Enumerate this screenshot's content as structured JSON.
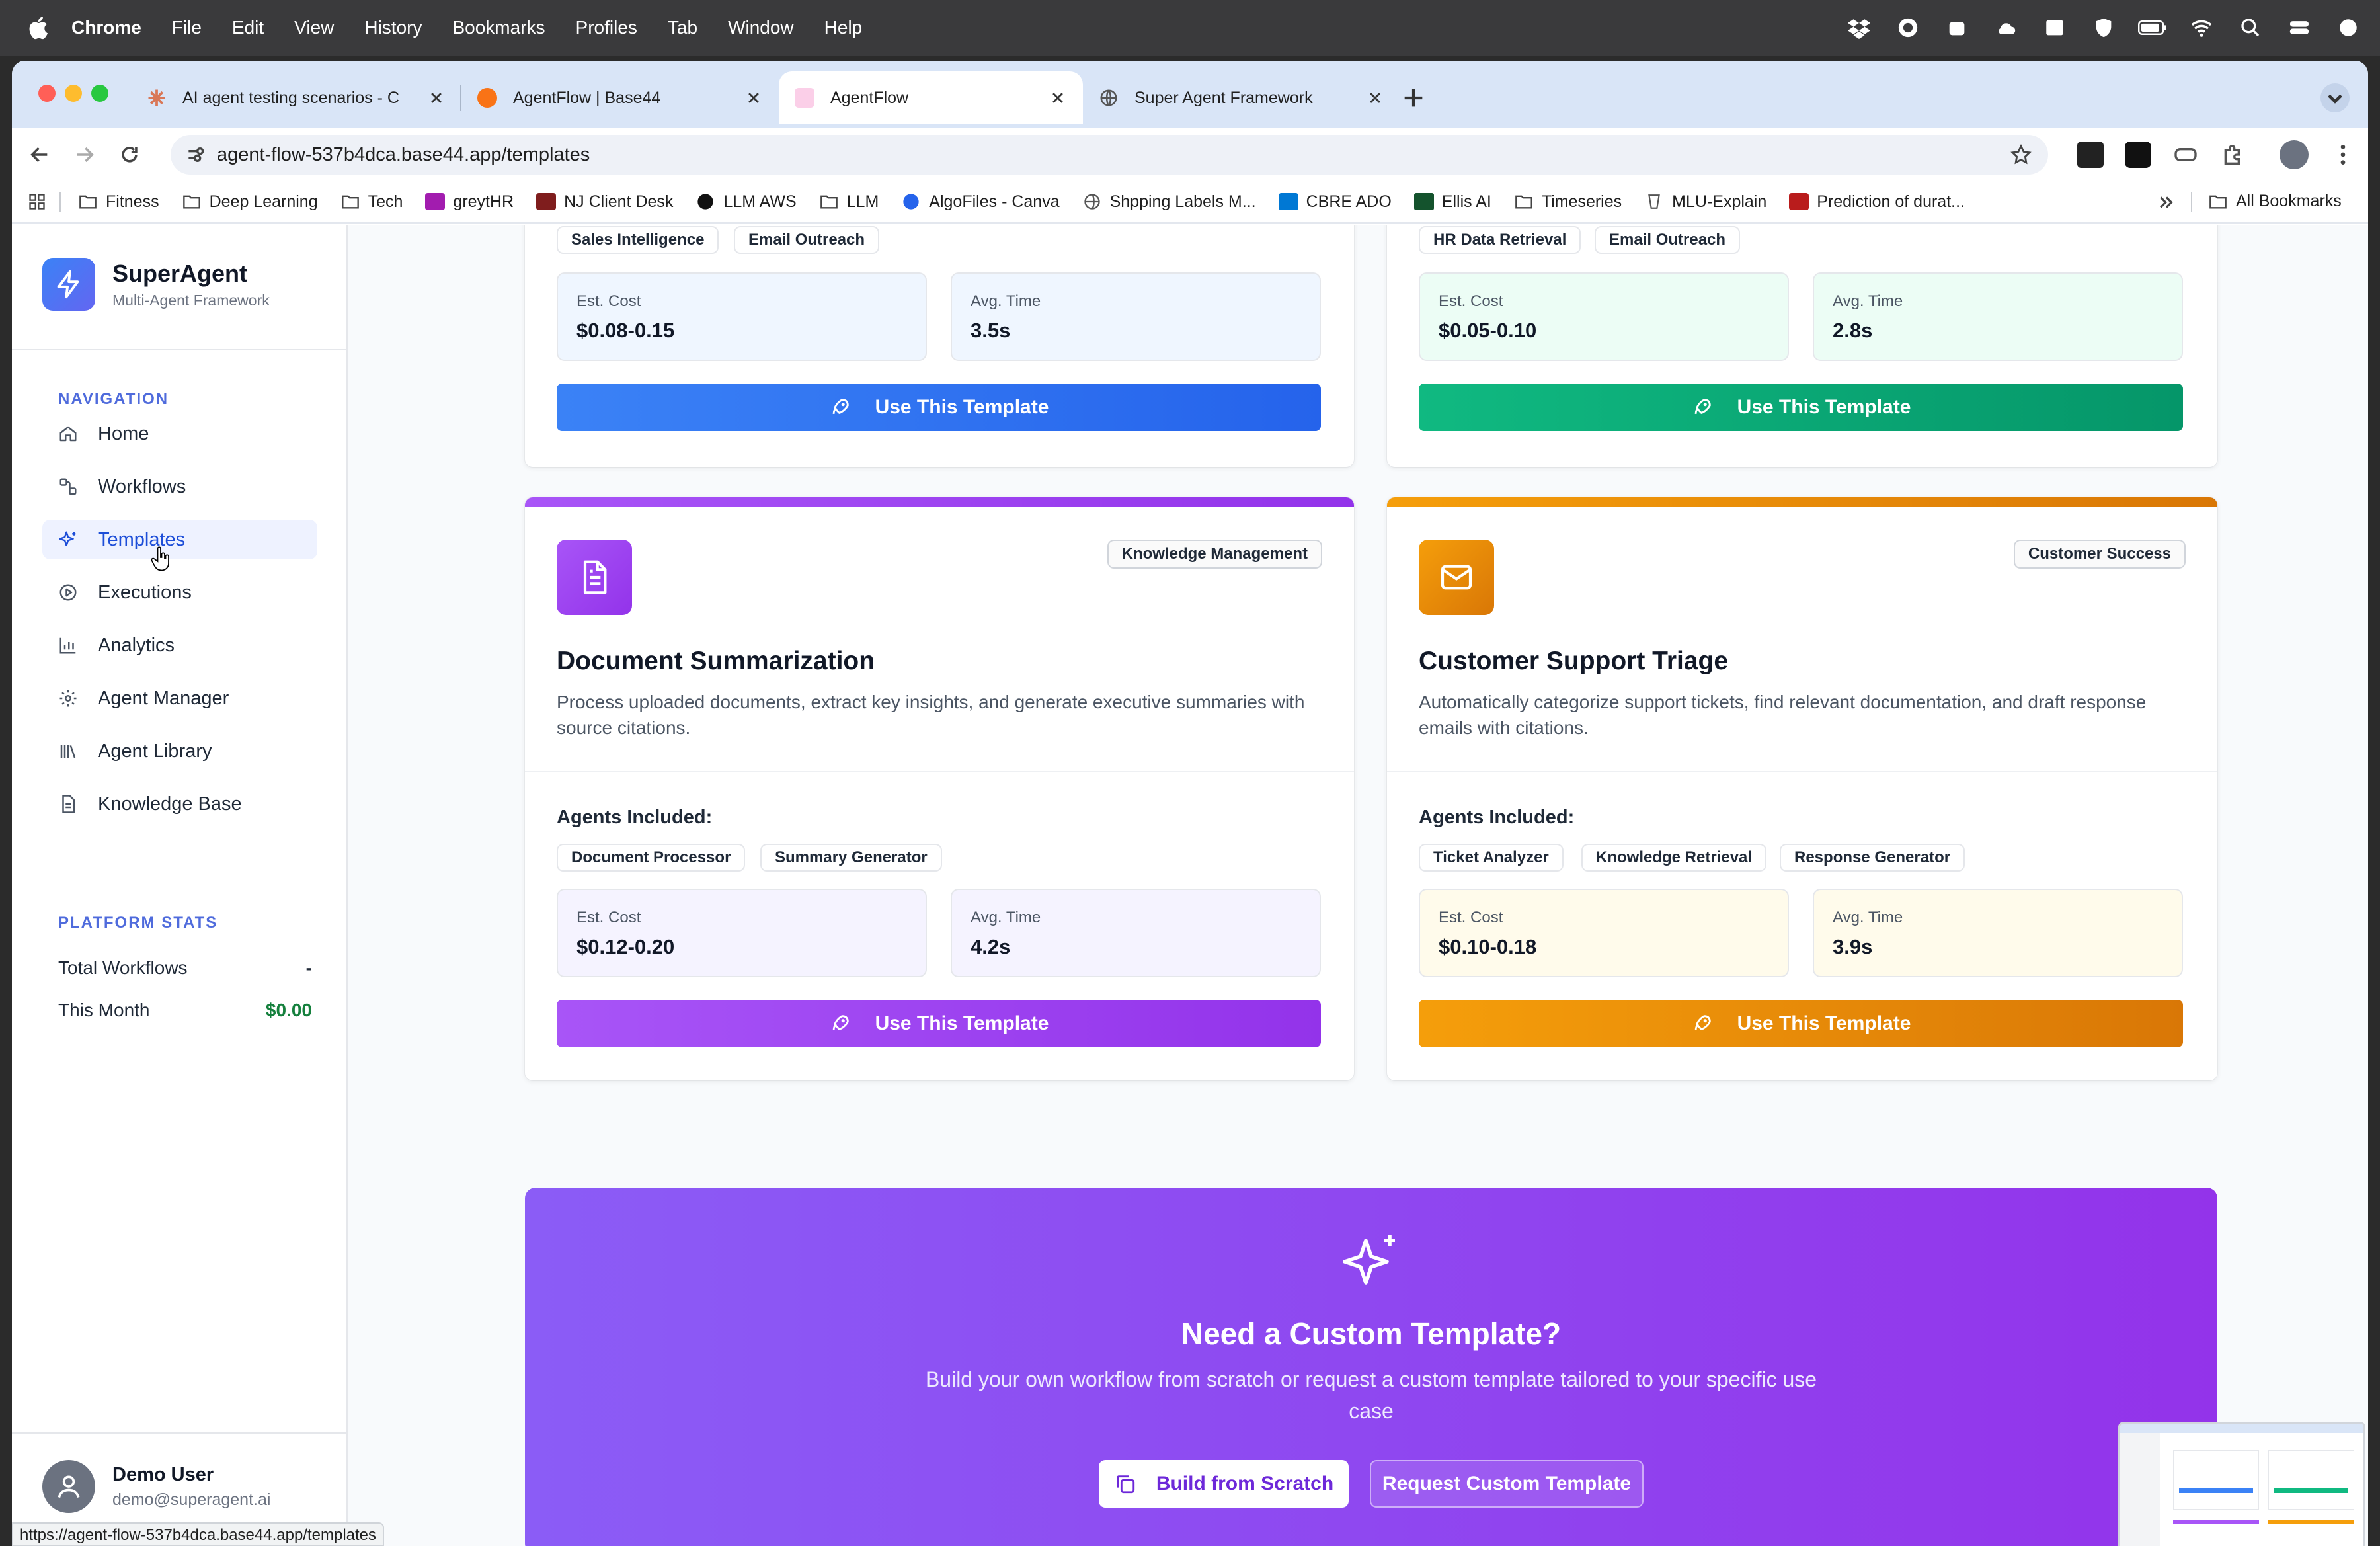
{
  "menubar": {
    "app": "Chrome",
    "items": [
      "File",
      "Edit",
      "View",
      "History",
      "Bookmarks",
      "Profiles",
      "Tab",
      "Window",
      "Help"
    ]
  },
  "tabs": [
    {
      "title": "AI agent testing scenarios - C",
      "favicon_color": "#d97757"
    },
    {
      "title": "AgentFlow | Base44",
      "favicon_color": "#f97316"
    },
    {
      "title": "AgentFlow",
      "favicon_color": "#ec4899"
    },
    {
      "title": "Super Agent Framework",
      "favicon_color": "#6b7280"
    }
  ],
  "address": {
    "url": "agent-flow-537b4dca.base44.app/templates"
  },
  "bookmarks": [
    {
      "label": "Fitness",
      "icon": "folder-icon"
    },
    {
      "label": "Deep Learning",
      "icon": "folder-icon"
    },
    {
      "label": "Tech",
      "icon": "folder-icon"
    },
    {
      "label": "greytHR",
      "icon": "greythr-icon"
    },
    {
      "label": "NJ Client Desk",
      "icon": "nj-icon"
    },
    {
      "label": "LLM AWS",
      "icon": "github-icon"
    },
    {
      "label": "LLM",
      "icon": "folder-icon"
    },
    {
      "label": "AlgoFiles - Canva",
      "icon": "canva-icon"
    },
    {
      "label": "Shpping Labels M...",
      "icon": "globe-icon"
    },
    {
      "label": "CBRE ADO",
      "icon": "ado-icon"
    },
    {
      "label": "Ellis AI",
      "icon": "cbre-icon"
    },
    {
      "label": "Timeseries",
      "icon": "folder-icon"
    },
    {
      "label": "MLU-Explain",
      "icon": "mlu-icon"
    },
    {
      "label": "Prediction of durat...",
      "icon": "paper-icon"
    }
  ],
  "bookmarks_all": "All Bookmarks",
  "sidebar": {
    "brand": {
      "name": "SuperAgent",
      "subtitle": "Multi-Agent Framework"
    },
    "nav_heading": "NAVIGATION",
    "nav": [
      {
        "label": "Home",
        "icon": "home-icon"
      },
      {
        "label": "Workflows",
        "icon": "workflow-icon"
      },
      {
        "label": "Templates",
        "icon": "sparkles-icon",
        "active": true
      },
      {
        "label": "Executions",
        "icon": "play-circle-icon"
      },
      {
        "label": "Analytics",
        "icon": "bar-chart-icon"
      },
      {
        "label": "Agent Manager",
        "icon": "gear-icon"
      },
      {
        "label": "Agent Library",
        "icon": "library-icon"
      },
      {
        "label": "Knowledge Base",
        "icon": "document-icon"
      }
    ],
    "stats_heading": "PLATFORM STATS",
    "stats": [
      {
        "label": "Total Workflows",
        "value": "-"
      },
      {
        "label": "This Month",
        "value": "$0.00"
      }
    ],
    "user": {
      "name": "Demo User",
      "email": "demo@superagent.ai"
    }
  },
  "cards_top": [
    {
      "chips": [
        "Sales Intelligence",
        "Email Outreach"
      ],
      "cost_label": "Est. Cost",
      "cost": "$0.08-0.15",
      "time_label": "Avg. Time",
      "time": "3.5s",
      "button": "Use This Template",
      "accent": "#3b82f6"
    },
    {
      "chips": [
        "HR Data Retrieval",
        "Email Outreach"
      ],
      "cost_label": "Est. Cost",
      "cost": "$0.05-0.10",
      "time_label": "Avg. Time",
      "time": "2.8s",
      "button": "Use This Template",
      "accent": "#10b981"
    }
  ],
  "cards": [
    {
      "category": "Knowledge Management",
      "icon": "document-icon",
      "title": "Document Summarization",
      "description": "Process uploaded documents, extract key insights, and generate executive summaries with source citations.",
      "agents_heading": "Agents Included:",
      "agents": [
        "Document Processor",
        "Summary Generator"
      ],
      "cost_label": "Est. Cost",
      "cost": "$0.12-0.20",
      "time_label": "Avg. Time",
      "time": "4.2s",
      "button": "Use This Template",
      "accent": "#a855f7"
    },
    {
      "category": "Customer Success",
      "icon": "mail-icon",
      "title": "Customer Support Triage",
      "description": "Automatically categorize support tickets, find relevant documentation, and draft response emails with citations.",
      "agents_heading": "Agents Included:",
      "agents": [
        "Ticket Analyzer",
        "Knowledge Retrieval",
        "Response Generator"
      ],
      "cost_label": "Est. Cost",
      "cost": "$0.10-0.18",
      "time_label": "Avg. Time",
      "time": "3.9s",
      "button": "Use This Template",
      "accent": "#f59e0b"
    }
  ],
  "custom": {
    "title": "Need a Custom Template?",
    "description": "Build your own workflow from scratch or request a custom template tailored to your specific use case",
    "primary": "Build from Scratch",
    "secondary": "Request Custom Template"
  },
  "status_url": "https://agent-flow-537b4dca.base44.app/templates"
}
